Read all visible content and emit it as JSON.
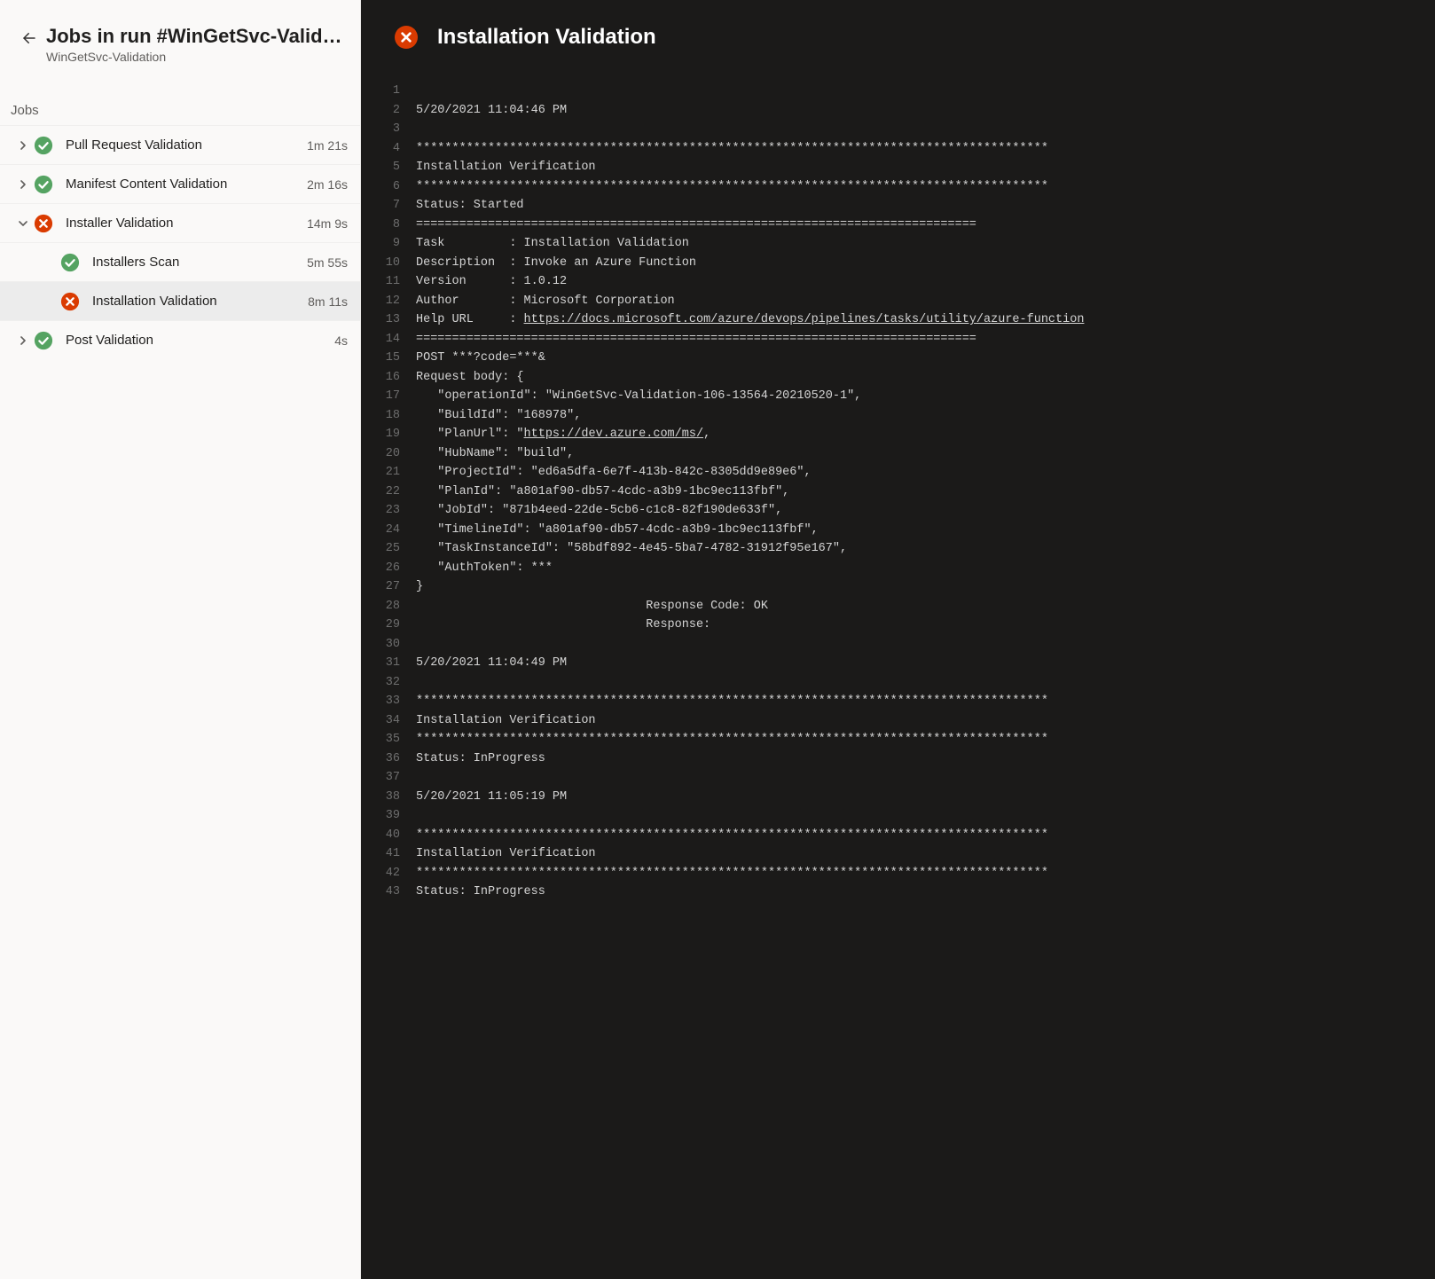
{
  "header": {
    "title": "Jobs in run #WinGetSvc-Valida…",
    "subtitle": "WinGetSvc-Validation"
  },
  "section_label": "Jobs",
  "jobs": [
    {
      "label": "Pull Request Validation",
      "duration": "1m 21s",
      "status": "success",
      "expanded": false,
      "hasChildren": true
    },
    {
      "label": "Manifest Content Validation",
      "duration": "2m 16s",
      "status": "success",
      "expanded": false,
      "hasChildren": true
    },
    {
      "label": "Installer Validation",
      "duration": "14m 9s",
      "status": "fail",
      "expanded": true,
      "hasChildren": true
    },
    {
      "label": "Post Validation",
      "duration": "4s",
      "status": "success",
      "expanded": false,
      "hasChildren": true
    }
  ],
  "steps": [
    {
      "label": "Installers Scan",
      "duration": "5m 55s",
      "status": "success",
      "selected": false
    },
    {
      "label": "Installation Validation",
      "duration": "8m 11s",
      "status": "fail",
      "selected": true
    }
  ],
  "log": {
    "title": "Installation Validation",
    "status": "fail",
    "lines": [
      {
        "n": 1,
        "t": ""
      },
      {
        "n": 2,
        "t": "5/20/2021 11:04:46 PM"
      },
      {
        "n": 3,
        "t": ""
      },
      {
        "n": 4,
        "t": "****************************************************************************************"
      },
      {
        "n": 5,
        "t": "Installation Verification"
      },
      {
        "n": 6,
        "t": "****************************************************************************************"
      },
      {
        "n": 7,
        "t": "Status: Started"
      },
      {
        "n": 8,
        "t": "=============================================================================="
      },
      {
        "n": 9,
        "t": "Task         : Installation Validation"
      },
      {
        "n": 10,
        "t": "Description  : Invoke an Azure Function"
      },
      {
        "n": 11,
        "t": "Version      : 1.0.12"
      },
      {
        "n": 12,
        "t": "Author       : Microsoft Corporation"
      },
      {
        "n": 13,
        "t": "Help URL     : ",
        "link": "https://docs.microsoft.com/azure/devops/pipelines/tasks/utility/azure-function"
      },
      {
        "n": 14,
        "t": "=============================================================================="
      },
      {
        "n": 15,
        "t": "POST ***?code=***&"
      },
      {
        "n": 16,
        "t": "Request body: {"
      },
      {
        "n": 17,
        "t": "   \"operationId\": \"WinGetSvc-Validation-106-13564-20210520-1\","
      },
      {
        "n": 18,
        "t": "   \"BuildId\": \"168978\","
      },
      {
        "n": 19,
        "t": "   \"PlanUrl\": \"",
        "link": "https://dev.azure.com/ms/",
        "tail": ","
      },
      {
        "n": 20,
        "t": "   \"HubName\": \"build\","
      },
      {
        "n": 21,
        "t": "   \"ProjectId\": \"ed6a5dfa-6e7f-413b-842c-8305dd9e89e6\","
      },
      {
        "n": 22,
        "t": "   \"PlanId\": \"a801af90-db57-4cdc-a3b9-1bc9ec113fbf\","
      },
      {
        "n": 23,
        "t": "   \"JobId\": \"871b4eed-22de-5cb6-c1c8-82f190de633f\","
      },
      {
        "n": 24,
        "t": "   \"TimelineId\": \"a801af90-db57-4cdc-a3b9-1bc9ec113fbf\","
      },
      {
        "n": 25,
        "t": "   \"TaskInstanceId\": \"58bdf892-4e45-5ba7-4782-31912f95e167\","
      },
      {
        "n": 26,
        "t": "   \"AuthToken\": ***"
      },
      {
        "n": 27,
        "t": "}"
      },
      {
        "n": 28,
        "t": "                                Response Code: OK"
      },
      {
        "n": 29,
        "t": "                                Response:"
      },
      {
        "n": 30,
        "t": ""
      },
      {
        "n": 31,
        "t": "5/20/2021 11:04:49 PM"
      },
      {
        "n": 32,
        "t": ""
      },
      {
        "n": 33,
        "t": "****************************************************************************************"
      },
      {
        "n": 34,
        "t": "Installation Verification"
      },
      {
        "n": 35,
        "t": "****************************************************************************************"
      },
      {
        "n": 36,
        "t": "Status: InProgress"
      },
      {
        "n": 37,
        "t": ""
      },
      {
        "n": 38,
        "t": "5/20/2021 11:05:19 PM"
      },
      {
        "n": 39,
        "t": ""
      },
      {
        "n": 40,
        "t": "****************************************************************************************"
      },
      {
        "n": 41,
        "t": "Installation Verification"
      },
      {
        "n": 42,
        "t": "****************************************************************************************"
      },
      {
        "n": 43,
        "t": "Status: InProgress"
      }
    ]
  }
}
